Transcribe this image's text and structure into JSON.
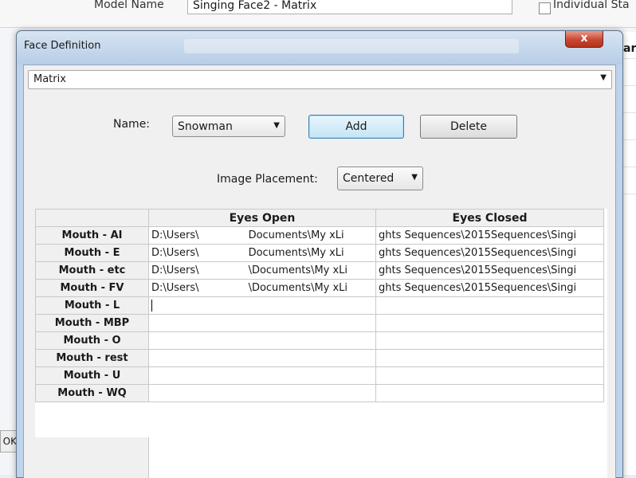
{
  "background": {
    "model_label": "Model Name",
    "model_value": "Singing Face2 - Matrix",
    "checkbox_label": "Individual Sta",
    "right_text": "ar",
    "left_button": "OK"
  },
  "dialog": {
    "title": "Face Definition",
    "close_symbol": "x",
    "type_select": "Matrix",
    "name_label": "Name:",
    "name_value": "Snowman",
    "add_label": "Add",
    "delete_label": "Delete",
    "placement_label": "Image Placement:",
    "placement_value": "Centered"
  },
  "grid": {
    "columns": [
      "",
      "Eyes Open",
      "Eyes Closed"
    ],
    "rows": [
      {
        "label": "Mouth - AI",
        "open_a": "D:\\Users\\",
        "open_b": "Documents\\My xLi",
        "closed": "ghts Sequences\\2015Sequences\\Singi"
      },
      {
        "label": "Mouth - E",
        "open_a": "D:\\Users\\",
        "open_b": "Documents\\My xLi",
        "closed": "ghts Sequences\\2015Sequences\\Singi"
      },
      {
        "label": "Mouth - etc",
        "open_a": "D:\\Users\\",
        "open_b": "\\Documents\\My xLi",
        "closed": "ghts Sequences\\2015Sequences\\Singi"
      },
      {
        "label": "Mouth - FV",
        "open_a": "D:\\Users\\",
        "open_b": "\\Documents\\My xLi",
        "closed": "ghts Sequences\\2015Sequences\\Singi"
      },
      {
        "label": "Mouth - L",
        "open_a": "",
        "open_b": "",
        "closed": ""
      },
      {
        "label": "Mouth - MBP",
        "open_a": "",
        "open_b": "",
        "closed": ""
      },
      {
        "label": "Mouth - O",
        "open_a": "",
        "open_b": "",
        "closed": ""
      },
      {
        "label": "Mouth - rest",
        "open_a": "",
        "open_b": "",
        "closed": ""
      },
      {
        "label": "Mouth - U",
        "open_a": "",
        "open_b": "",
        "closed": ""
      },
      {
        "label": "Mouth - WQ",
        "open_a": "",
        "open_b": "",
        "closed": ""
      }
    ]
  }
}
